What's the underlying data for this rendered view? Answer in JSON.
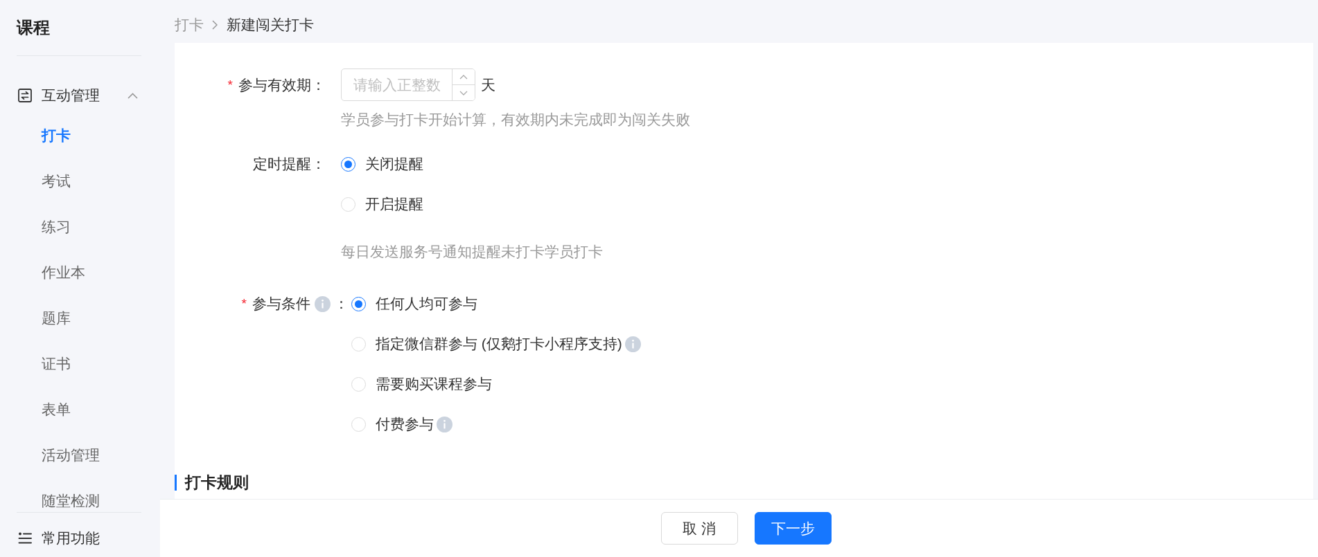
{
  "sidebar": {
    "title": "课程",
    "groups": [
      {
        "label": "互动管理",
        "expanded": true,
        "items": [
          {
            "label": "打卡",
            "selected": true
          },
          {
            "label": "考试",
            "selected": false
          },
          {
            "label": "练习",
            "selected": false
          },
          {
            "label": "作业本",
            "selected": false
          },
          {
            "label": "题库",
            "selected": false
          },
          {
            "label": "证书",
            "selected": false
          },
          {
            "label": "表单",
            "selected": false
          },
          {
            "label": "活动管理",
            "selected": false
          },
          {
            "label": "随堂检测",
            "selected": false
          }
        ]
      }
    ],
    "pinned": {
      "label": "常用功能"
    }
  },
  "breadcrumb": [
    "打卡",
    "新建闯关打卡"
  ],
  "form": {
    "fields": [
      {
        "kind": "number",
        "required_mark": "*",
        "label": "参与有效期：",
        "info": false,
        "placeholder": "请输入正整数",
        "unit": "天",
        "hint": "学员参与打卡开始计算，有效期内未完成即为闯关失败"
      },
      {
        "kind": "radio",
        "label": "定时提醒：",
        "info": false,
        "options": [
          {
            "label": "关闭提醒",
            "selected": true,
            "info": false
          },
          {
            "label": "开启提醒",
            "selected": false,
            "info": false
          }
        ],
        "hint": "每日发送服务号通知提醒未打卡学员打卡"
      },
      {
        "kind": "radio",
        "required_mark": "*",
        "label": "参与条件",
        "info": true,
        "label_suffix": "：",
        "options": [
          {
            "label": "任何人均可参与",
            "selected": true,
            "info": false
          },
          {
            "label": "指定微信群参与 (仅鹅打卡小程序支持)",
            "selected": false,
            "info": true
          },
          {
            "label": "需要购买课程参与",
            "selected": false,
            "info": false
          },
          {
            "label": "付费参与",
            "selected": false,
            "info": true
          }
        ]
      }
    ]
  },
  "section": {
    "title": "打卡规则"
  },
  "footer": {
    "buttons": [
      {
        "label": "取 消",
        "kind": "default"
      },
      {
        "label": "下一步",
        "kind": "primary"
      }
    ]
  }
}
